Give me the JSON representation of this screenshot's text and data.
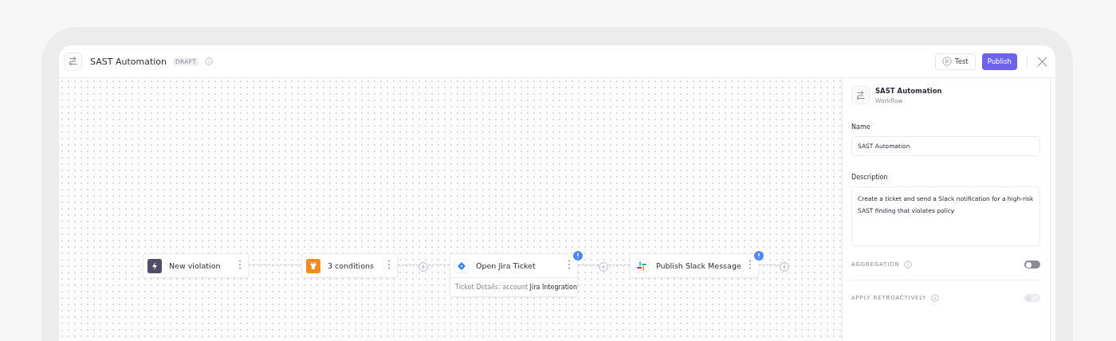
{
  "header": {
    "title": "SAST Automation",
    "badge": "DRAFT",
    "test_button": "Test",
    "publish_button": "Publish"
  },
  "nodes": [
    {
      "kind": "trigger",
      "label": "New violation",
      "warning": false,
      "add_after": false
    },
    {
      "kind": "condition",
      "label": "3 conditions",
      "warning": false,
      "add_after": true
    },
    {
      "kind": "jira",
      "label": "Open Jira Ticket",
      "detail": "Ticket Details: account **Jira Integration**",
      "warning": true,
      "add_after": true
    },
    {
      "kind": "slack",
      "label": "Publish Slack Message",
      "warning": true,
      "add_after": true
    }
  ],
  "panel": {
    "title": "SAST Automation",
    "subtitle": "Workflow",
    "name_label": "Name",
    "name_value": "SAST Automation",
    "description_label": "Description",
    "description_value": "Create a ticket and send a Slack notification for a high-risk SAST finding that violates policy",
    "toggles": [
      {
        "label": "AGGREGATION",
        "on": false,
        "disabled": false
      },
      {
        "label": "APPLY RETROACTIVELY",
        "on": false,
        "disabled": true
      }
    ]
  }
}
